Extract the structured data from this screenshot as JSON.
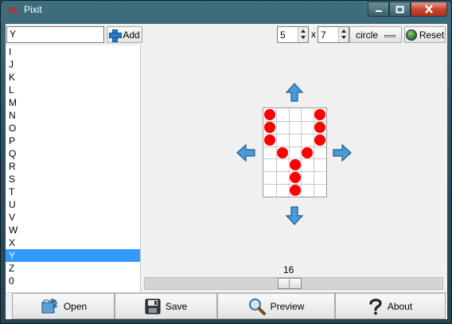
{
  "window": {
    "title": "Pixit",
    "app_icon_text": "Tk"
  },
  "name_input": {
    "value": "Y"
  },
  "add_button": {
    "label": "Add"
  },
  "glyph_list": {
    "items": [
      "I",
      "J",
      "K",
      "L",
      "M",
      "N",
      "O",
      "P",
      "Q",
      "R",
      "S",
      "T",
      "U",
      "V",
      "W",
      "X",
      "Y",
      "Z",
      "0"
    ],
    "selected": "Y"
  },
  "size": {
    "width": "5",
    "separator": "x",
    "height": "7"
  },
  "shape_select": {
    "value": "circle"
  },
  "reset_button": {
    "label": "Reset"
  },
  "pixel_grid": {
    "cols": 5,
    "rows": 7,
    "filled": [
      [
        0,
        0
      ],
      [
        4,
        0
      ],
      [
        0,
        1
      ],
      [
        4,
        1
      ],
      [
        0,
        2
      ],
      [
        4,
        2
      ],
      [
        1,
        3
      ],
      [
        3,
        3
      ],
      [
        2,
        4
      ],
      [
        2,
        5
      ],
      [
        2,
        6
      ]
    ],
    "dot_color": "#ff0000"
  },
  "slider": {
    "value": "16"
  },
  "bottom_buttons": [
    {
      "label": "Open",
      "icon": "open-icon"
    },
    {
      "label": "Save",
      "icon": "floppy-disk-icon"
    },
    {
      "label": "Preview",
      "icon": "magnifier-icon"
    },
    {
      "label": "About",
      "icon": "question-mark-icon"
    }
  ],
  "colors": {
    "selection": "#3399ff",
    "arrow": "#2f7db8"
  }
}
